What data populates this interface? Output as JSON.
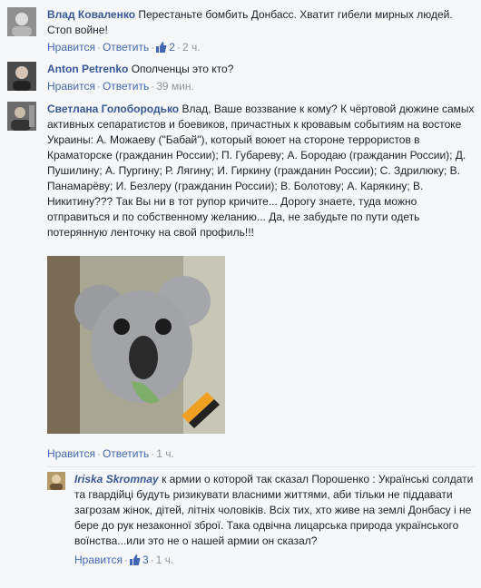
{
  "comments": [
    {
      "author": "Влад Коваленко",
      "text": "Перестаньте бомбить Донбасс. Хватит гибели мирных людей. Стоп войне!",
      "actions": {
        "like": "Нравится",
        "reply": "Ответить",
        "likes_count": "2",
        "time": "2 ч."
      }
    },
    {
      "author": "Anton Petrenko",
      "text": "Ополченцы это кто?",
      "actions": {
        "like": "Нравится",
        "reply": "Ответить",
        "time": "39 мин."
      }
    },
    {
      "author": "Светлана Голобородько",
      "text": "Влад, Ваше воззвание к кому? К чёртовой дюжине самых активных сепаратистов и боевиков, причастных к кровавым событиям на востоке Украины: А. Можаеву (\"Бабай\"), который воюет на стороне террористов в Краматорске (гражданин России); П. Губареву; А. Бородаю (гражданин России); Д. Пушилину; А. Пургину; Р. Лягину; И. Гиркину (гражданин России); С. Здрилюку; В. Панамарёву; И. Безлеру (гражданин России); В. Болотову; А. Карякину; В. Никитину??? Так Вы ни в тот рупор кричите... Дорогу знаете, туда можно отправиться и по собственному желанию... Да, не забудьте по пути одеть потерянную ленточку на свой профиль!!!",
      "actions": {
        "like": "Нравится",
        "reply": "Ответить",
        "time": "1 ч."
      }
    }
  ],
  "reply": {
    "author": "Iriska Skromnay",
    "text": "к армии о которой так сказал Порошенко : Українські солдати та гвардійці будуть ризикувати власними життями, аби тільки не піддавати загрозам жінок, дітей, літніх чоловіків. Всіх тих, хто живе на землі Донбасу і не бере до рук незаконної зброї. Така одвічна лицарська природа українського воїнства...или это не о нашей армии он сказал?",
    "actions": {
      "like": "Нравится",
      "reply": "Ответить",
      "likes_count": "3",
      "time": "1 ч."
    }
  },
  "colors": {
    "link": "#365899",
    "action": "#4267b2",
    "meta": "#90949c",
    "bg": "#f6f7f9"
  }
}
